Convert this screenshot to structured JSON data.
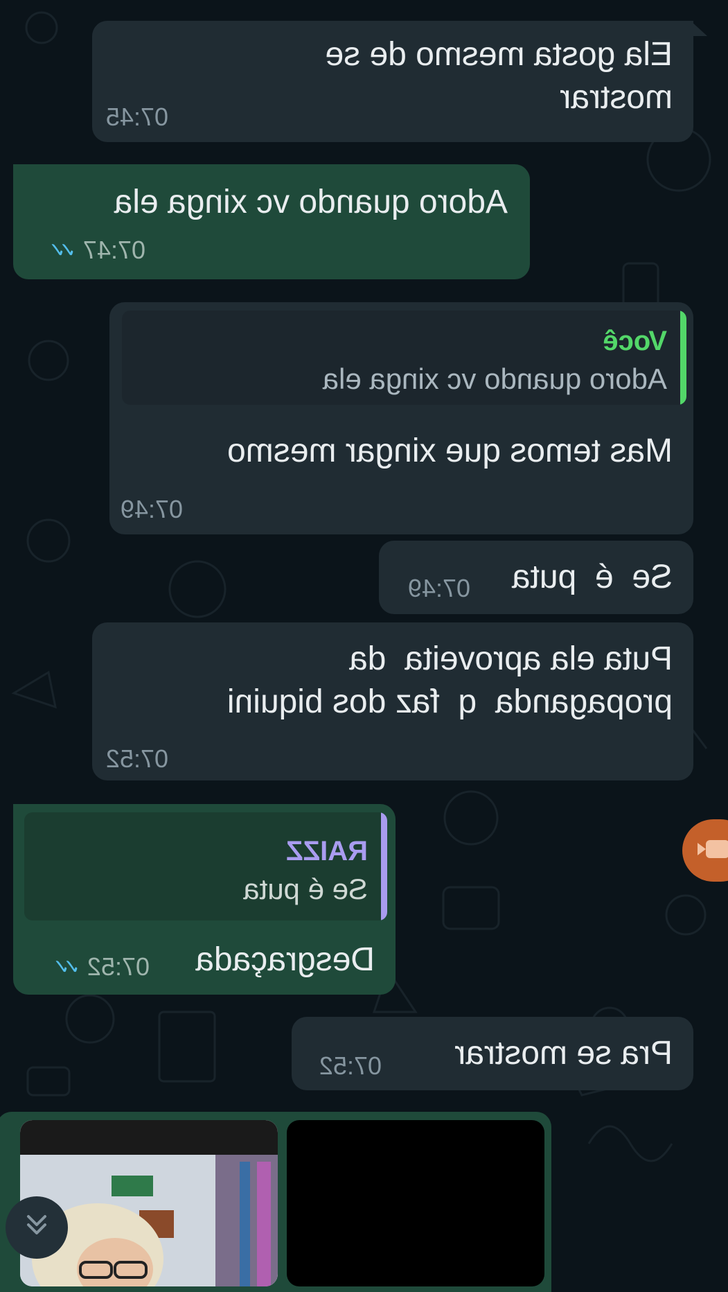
{
  "messages": [
    {
      "id": 1,
      "direction": "incoming",
      "text": "Ela gosta mesmo de se\nmostrar",
      "time": "07:45"
    },
    {
      "id": 2,
      "direction": "outgoing",
      "text": "Adoro quando vc xinga ela",
      "time": "07:47",
      "status": "read"
    },
    {
      "id": 3,
      "direction": "incoming",
      "quote_author": "Você",
      "quote_text": "Adoro quando vc xinga ela",
      "text": "Mas temos que xingar mesmo",
      "time": "07:49"
    },
    {
      "id": 4,
      "direction": "incoming",
      "text": "Se  é  puta",
      "time": "07:49"
    },
    {
      "id": 5,
      "direction": "incoming",
      "text": "Puta ela aproveita  da\npropaganda  q  faz dos biquini",
      "time": "07:52"
    },
    {
      "id": 6,
      "direction": "outgoing",
      "quote_author": "RAIZZ",
      "quote_text": "Se  é  puta",
      "text": "Desgraçada",
      "time": "07:52",
      "status": "read"
    },
    {
      "id": 7,
      "direction": "incoming",
      "text": "Pra se mostrar",
      "time": "07:52"
    }
  ],
  "media_message": {
    "direction": "outgoing",
    "items": [
      "photo",
      "video"
    ]
  },
  "colors": {
    "background": "#0b141a",
    "incoming_bubble": "#202c33",
    "outgoing_bubble": "#1f4a3a",
    "quote_bar_you": "#53d769",
    "quote_bar_raizz": "#a99cf0",
    "read_ticks": "#53bdeb",
    "call_button": "#c4602a"
  },
  "icons": {
    "read_receipt": "double-check-icon",
    "scroll_down": "double-chevron-down-icon",
    "floating_call": "video-camera-icon"
  }
}
